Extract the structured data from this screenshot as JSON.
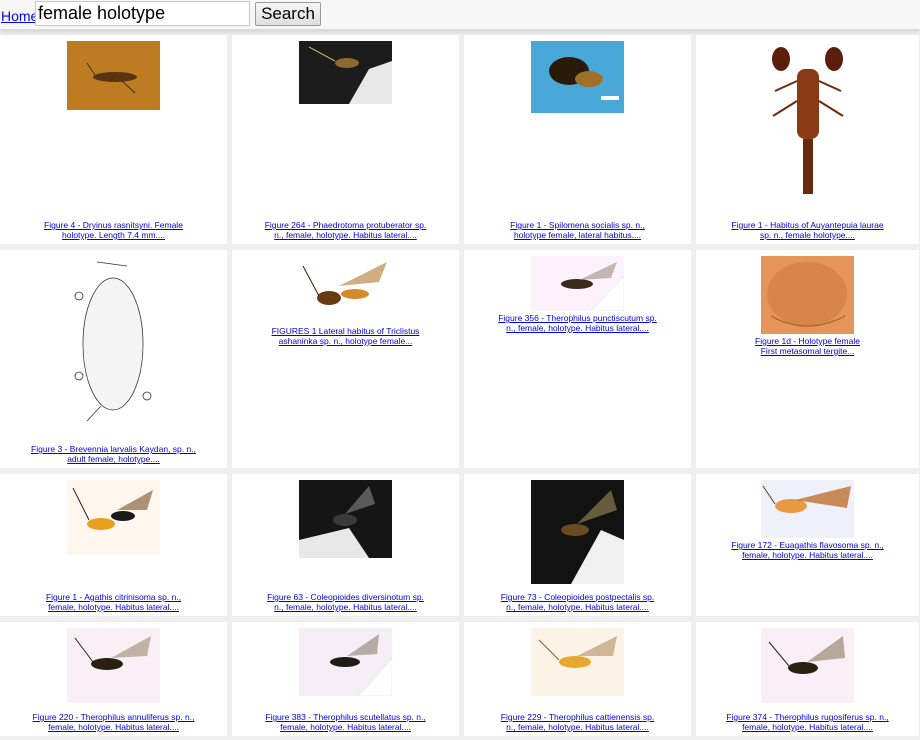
{
  "header": {
    "home_label": "Home",
    "search_value": "female holotype",
    "search_button_label": "Search"
  },
  "results": [
    {
      "caption_line1": "Figure 4 - Dryinus rasnitsyni. Female",
      "caption_line2": "holotype. Length 7.4 mm...."
    },
    {
      "caption_line1": "Figure 264 - Phaedrotoma protuberator sp.",
      "caption_line2": "n., female, holotype. Habitus lateral...."
    },
    {
      "caption_line1": "Figure 1 - Spilomena socialis sp. n.,",
      "caption_line2": "holotype female, lateral habitus...."
    },
    {
      "caption_line1": "Figure 1 - Habitus of Auyantepuia laurae",
      "caption_line2": "sp. n., female holotype...."
    },
    {
      "caption_line1": "Figure 3 - Brevennia larvalis Kaydan, sp. n.,",
      "caption_line2": "adult female, holotype...."
    },
    {
      "caption_line1": "FIGURES 1 Lateral habitus of Triclistus",
      "caption_line2": "ashaninka sp. n., holotype female..."
    },
    {
      "caption_line1": "Figure 356 - Therophilus punctiscutum sp.",
      "caption_line2": "n., female, holotype. Habitus lateral...."
    },
    {
      "caption_line1": "Figure 1d - Holotype female",
      "caption_line2": "First metasomal tergite..."
    },
    {
      "caption_line1": "Figure 1 - Agathis citrinisoma sp. n.,",
      "caption_line2": "female, holotype. Habitus lateral...."
    },
    {
      "caption_line1": "Figure 63 - Coleopioides diversinotum sp.",
      "caption_line2": "n., female, holotype. Habitus lateral...."
    },
    {
      "caption_line1": "Figure 73 - Coleopioides postpectalis sp.",
      "caption_line2": "n., female, holotype. Habitus lateral...."
    },
    {
      "caption_line1": "Figure 172 - Euagathis flavosoma sp. n.,",
      "caption_line2": "female, holotype. Habitus lateral...."
    },
    {
      "caption_line1": "Figure 220 - Therophilus annuliferus sp. n.,",
      "caption_line2": "female, holotype. Habitus lateral...."
    },
    {
      "caption_line1": "Figure 383 - Therophilus scutellatus sp. n.,",
      "caption_line2": "female, holotype. Habitus lateral...."
    },
    {
      "caption_line1": "Figure 229 - Therophilus cattienensis sp.",
      "caption_line2": "n., female, holotype. Habitus lateral...."
    },
    {
      "caption_line1": "Figure 374 - Therophilus rugosiferus sp. n.,",
      "caption_line2": "female, holotype. Habitus lateral...."
    }
  ]
}
